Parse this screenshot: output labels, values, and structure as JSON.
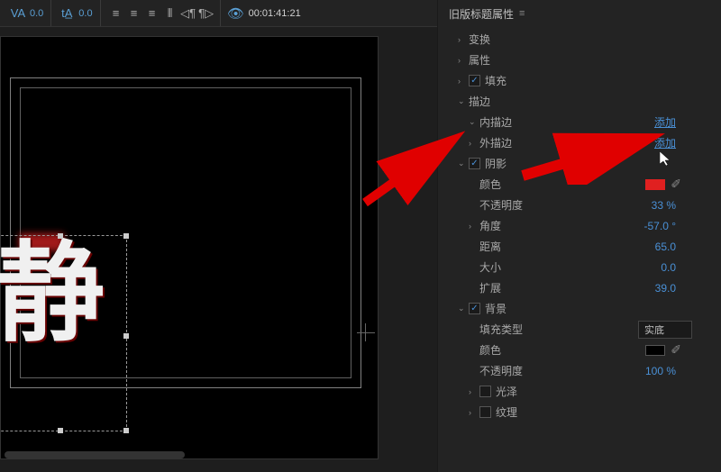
{
  "toolbar": {
    "tracking_value": "0.0",
    "baseline_value": "0.0",
    "timecode": "00:01:41:21"
  },
  "canvas": {
    "text": "静"
  },
  "panel": {
    "title": "旧版标题属性",
    "sections": {
      "transform": "变换",
      "properties": "属性",
      "fill": "填充",
      "stroke": "描边",
      "inner_stroke": "内描边",
      "inner_stroke_action": "添加",
      "outer_stroke": "外描边",
      "outer_stroke_action": "添加",
      "shadow": "阴影",
      "shadow_color_label": "颜色",
      "shadow_color": "#e02020",
      "shadow_opacity_label": "不透明度",
      "shadow_opacity": "33 %",
      "shadow_angle_label": "角度",
      "shadow_angle": "-57.0 °",
      "shadow_distance_label": "距离",
      "shadow_distance": "65.0",
      "shadow_size_label": "大小",
      "shadow_size": "0.0",
      "shadow_spread_label": "扩展",
      "shadow_spread": "39.0",
      "background": "背景",
      "bg_fill_type_label": "填充类型",
      "bg_fill_type": "实底",
      "bg_color_label": "颜色",
      "bg_color": "#000000",
      "bg_opacity_label": "不透明度",
      "bg_opacity": "100 %",
      "bg_sheen": "光泽",
      "bg_texture": "纹理"
    }
  }
}
